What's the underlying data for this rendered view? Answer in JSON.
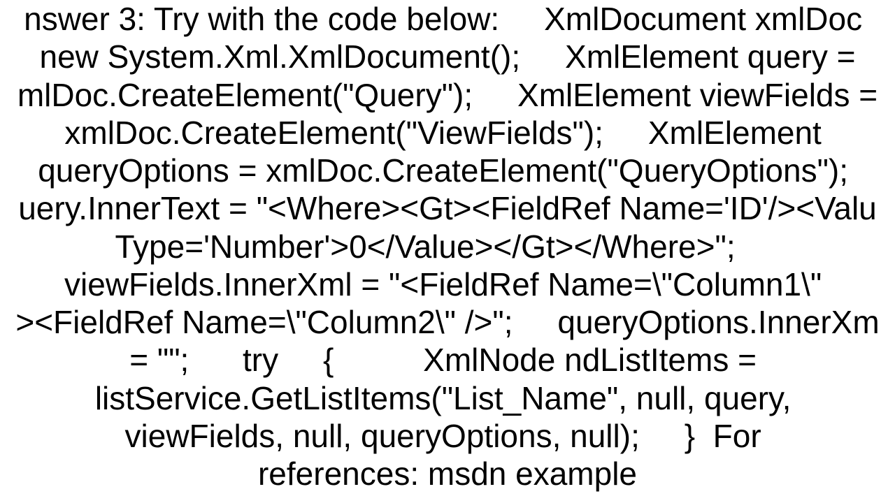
{
  "content": {
    "line1": "nswer 3: Try with the code below:     XmlDocument xmlDoc ",
    "line2": " new System.Xml.XmlDocument();     XmlElement query = ",
    "line3": "mlDoc.CreateElement(\"Query\");     XmlElement viewFields =",
    "line4": "xmlDoc.CreateElement(\"ViewFields\");     XmlElement ",
    "line5": "queryOptions = xmlDoc.CreateElement(\"QueryOptions\"); ",
    "line6": "uery.InnerText = \"<Where><Gt><FieldRef Name='ID'/><Valu",
    "line7": "Type='Number'>0</Value></Gt></Where>\";     ",
    "line8": "viewFields.InnerXml = \"<FieldRef Name=\\\"Column1\\\" ",
    "line9": "><FieldRef Name=\\\"Column2\\\" />\";     queryOptions.InnerXm",
    "line10": "= \"\";      try     {          XmlNode ndListItems = ",
    "line11": "listService.GetListItems(\"List_Name\", null, query, ",
    "line12": "viewFields, null, queryOptions, null);     }  For ",
    "line13": "references: msdn example"
  }
}
